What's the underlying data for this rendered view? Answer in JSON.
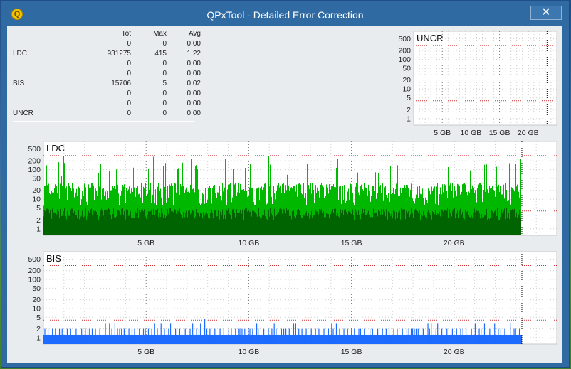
{
  "window": {
    "title": "QPxTool - Detailed Error Correction",
    "close_label": "✕",
    "icon_letter": "Q"
  },
  "stats": {
    "headers": [
      "",
      "Tot",
      "Max",
      "Avg"
    ],
    "rows": [
      [
        "",
        "0",
        "0",
        "0.00"
      ],
      [
        "LDC",
        "931275",
        "415",
        "1.22"
      ],
      [
        "",
        "0",
        "0",
        "0.00"
      ],
      [
        "",
        "0",
        "0",
        "0.00"
      ],
      [
        "BIS",
        "15706",
        "5",
        "0.02"
      ],
      [
        "",
        "0",
        "0",
        "0.00"
      ],
      [
        "",
        "0",
        "0",
        "0.00"
      ],
      [
        "UNCR",
        "0",
        "0",
        "0.00"
      ]
    ]
  },
  "chart_data": [
    {
      "type": "bar",
      "title": "UNCR",
      "scale": "log",
      "yticks": [
        500,
        200,
        100,
        50,
        20,
        10,
        5,
        2,
        1
      ],
      "xticks": [
        "5 GB",
        "10 GB",
        "15 GB",
        "20 GB"
      ],
      "x_max_gb": 25,
      "data_end_gb": 23.3,
      "red_lines": [
        300,
        4
      ],
      "grid": true,
      "values": [],
      "color": "#000000"
    },
    {
      "type": "bar",
      "title": "LDC",
      "scale": "log",
      "yticks": [
        500,
        200,
        100,
        50,
        20,
        10,
        5,
        2,
        1
      ],
      "xticks": [
        "5 GB",
        "10 GB",
        "15 GB",
        "20 GB"
      ],
      "x_max_gb": 25,
      "data_end_gb": 23.3,
      "red_lines": [
        300,
        4
      ],
      "grid": true,
      "total": 931275,
      "max": 415,
      "avg": 1.22,
      "series": [
        {
          "name": "LDC",
          "color": "#00b800",
          "typical_range": [
            4,
            50
          ]
        },
        {
          "name": "",
          "color": "#006400",
          "typical_range": [
            1,
            5
          ]
        }
      ]
    },
    {
      "type": "bar",
      "title": "BIS",
      "scale": "log",
      "yticks": [
        500,
        200,
        100,
        50,
        20,
        10,
        5,
        2,
        1
      ],
      "xticks": [
        "5 GB",
        "10 GB",
        "15 GB",
        "20 GB"
      ],
      "x_max_gb": 25,
      "data_end_gb": 23.3,
      "red_lines": [
        300,
        4
      ],
      "grid": true,
      "total": 15706,
      "max": 5,
      "avg": 0.02,
      "series": [
        {
          "name": "BIS",
          "color": "#1e6bff"
        }
      ]
    }
  ]
}
